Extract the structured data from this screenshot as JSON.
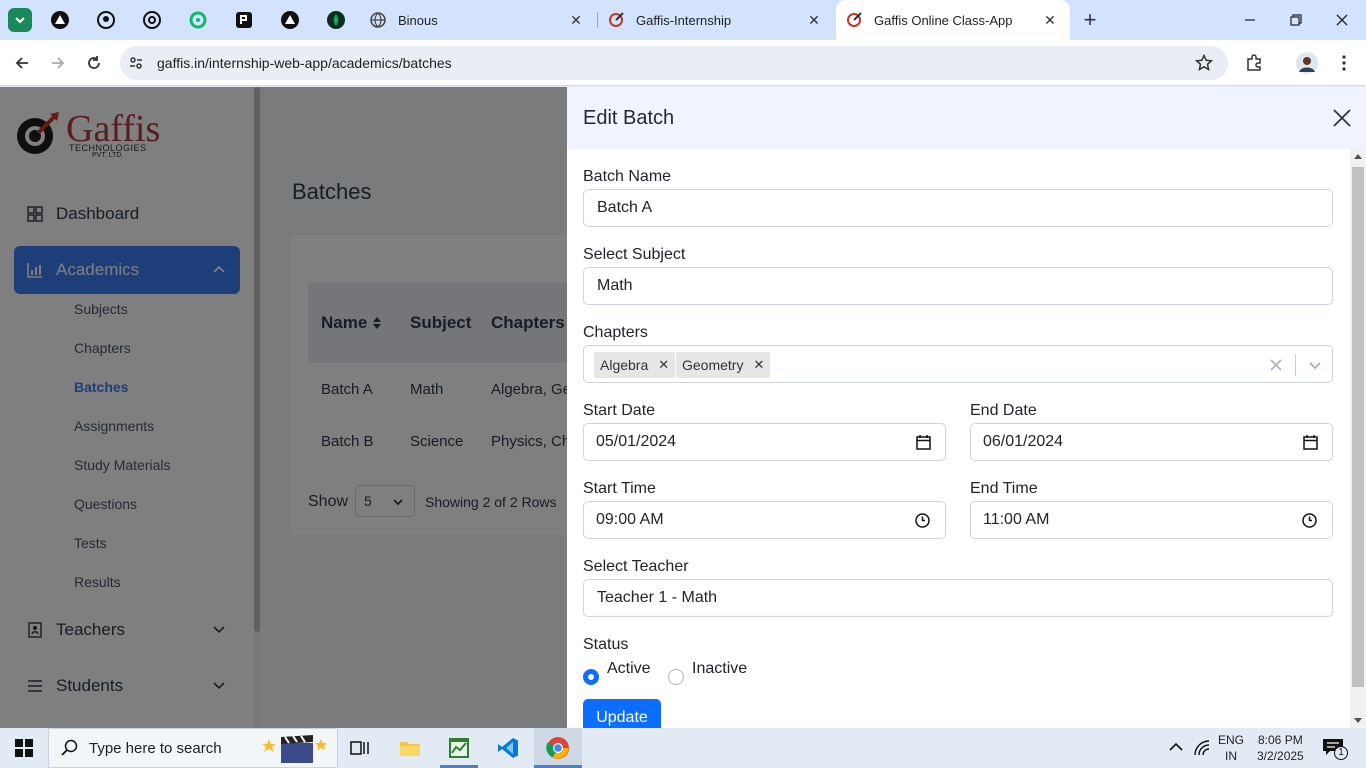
{
  "browser": {
    "tabs": [
      {
        "title": "Binous"
      },
      {
        "title": "Gaffis-Internship"
      },
      {
        "title": "Gaffis Online Class-App"
      }
    ],
    "url": "gaffis.in/internship-web-app/academics/batches"
  },
  "sidebar": {
    "logo_text": "Gaffis",
    "logo_sub": "TECHNOLOGIES",
    "logo_sub2": "PVT. LTD.",
    "items": [
      {
        "label": "Dashboard"
      },
      {
        "label": "Academics"
      },
      {
        "label": "Teachers"
      },
      {
        "label": "Students"
      }
    ],
    "sub_items": [
      {
        "label": "Subjects"
      },
      {
        "label": "Chapters"
      },
      {
        "label": "Batches"
      },
      {
        "label": "Assignments"
      },
      {
        "label": "Study Materials"
      },
      {
        "label": "Questions"
      },
      {
        "label": "Tests"
      },
      {
        "label": "Results"
      }
    ]
  },
  "main": {
    "title": "Batches",
    "table": {
      "headers": [
        "Name",
        "Subject",
        "Chapters"
      ],
      "rows": [
        [
          "Batch A",
          "Math",
          "Algebra, Ge"
        ],
        [
          "Batch B",
          "Science",
          "Physics, Ch"
        ]
      ]
    },
    "show_label": "Show",
    "show_value": "5",
    "showing_text": "Showing 2 of 2 Rows"
  },
  "drawer": {
    "title": "Edit Batch",
    "batch_name_label": "Batch Name",
    "batch_name_value": "Batch A",
    "subject_label": "Select Subject",
    "subject_value": "Math",
    "chapters_label": "Chapters",
    "chapters": [
      "Algebra",
      "Geometry"
    ],
    "start_date_label": "Start Date",
    "start_date_value": "05/01/2024",
    "end_date_label": "End Date",
    "end_date_value": "06/01/2024",
    "start_time_label": "Start Time",
    "start_time_value": "09:00 AM",
    "end_time_label": "End Time",
    "end_time_value": "11:00 AM",
    "teacher_label": "Select Teacher",
    "teacher_value": "Teacher 1 - Math",
    "status_label": "Status",
    "status_options": [
      "Active",
      "Inactive"
    ],
    "update_label": "Update"
  },
  "taskbar": {
    "search_placeholder": "Type here to search",
    "lang1": "ENG",
    "lang2": "IN",
    "time": "8:06 PM",
    "date": "3/2/2025",
    "notification_count": "1"
  },
  "colors": {
    "accent": "#3c7df3",
    "primary_button": "#0d6efd",
    "tabstrip": "#d3e3fd"
  }
}
